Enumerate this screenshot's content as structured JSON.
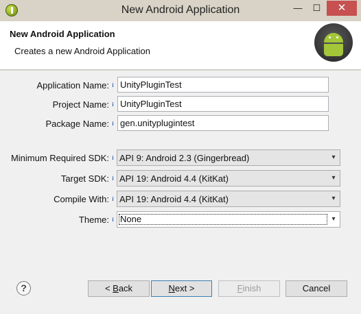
{
  "window": {
    "title": "New Android Application",
    "controls": {
      "minimize": "—",
      "maximize": "☐",
      "close": "✕"
    }
  },
  "header": {
    "title": "New Android Application",
    "subtitle": "Creates a new Android Application"
  },
  "form": {
    "application_name": {
      "label": "Application Name:",
      "value": "UnityPluginTest"
    },
    "project_name": {
      "label": "Project Name:",
      "value": "UnityPluginTest"
    },
    "package_name": {
      "label": "Package Name:",
      "value": "gen.unityplugintest"
    },
    "min_sdk": {
      "label": "Minimum Required SDK:",
      "value": "API 9: Android 2.3 (Gingerbread)"
    },
    "target_sdk": {
      "label": "Target SDK:",
      "value": "API 19: Android 4.4 (KitKat)"
    },
    "compile_with": {
      "label": "Compile With:",
      "value": "API 19: Android 4.4 (KitKat)"
    },
    "theme": {
      "label": "Theme:",
      "value": "None"
    },
    "info_marker": "i",
    "dropdown_arrow": "▾"
  },
  "footer": {
    "help": "?",
    "back": {
      "prefix": "< ",
      "mnemonic": "B",
      "rest": "ack"
    },
    "next": {
      "mnemonic": "N",
      "rest": "ext >"
    },
    "finish": {
      "mnemonic": "F",
      "rest": "inish"
    },
    "cancel": "Cancel"
  },
  "colors": {
    "titlebar": "#d8d3c6",
    "close_button": "#c75050",
    "android_green": "#a4c639",
    "default_button_border": "#3c7fb1"
  },
  "icons": [
    "android-app-icon",
    "android-logo-icon",
    "info-icon",
    "help-icon",
    "chevron-down-icon"
  ]
}
